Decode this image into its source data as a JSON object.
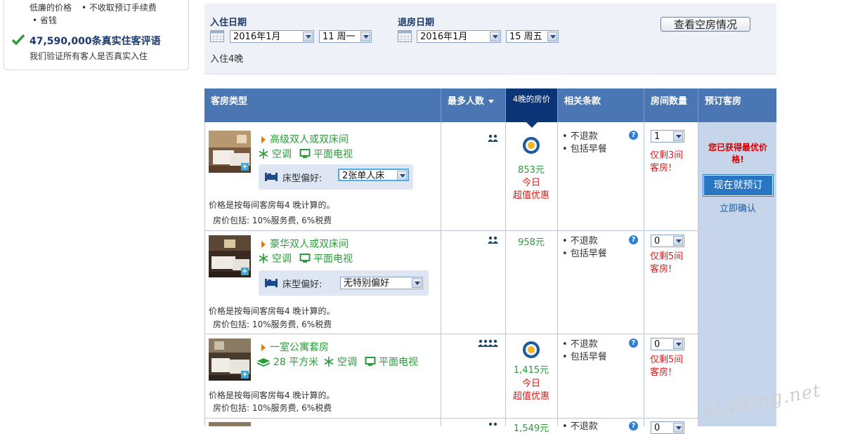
{
  "left_panel": {
    "line1_a": "低廉的价格",
    "line1_b": "• 不收取预订手续费",
    "line2": "• 省钱",
    "review_stat": "47,590,000条真实住客评语",
    "verify_note": "我们验证所有客人是否真实入住"
  },
  "search": {
    "checkin_label": "入住日期",
    "checkin_month": "2016年1月",
    "checkin_day": "11 周一",
    "checkout_label": "退房日期",
    "checkout_month": "2016年1月",
    "checkout_day": "15 周五",
    "nights": "入住4晚",
    "check_availability": "查看空房情况"
  },
  "table": {
    "headers": {
      "room_type": "客房类型",
      "max_people": "最多人数",
      "price": "4晚的房价",
      "conditions": "相关条款",
      "room_count": "房间数量",
      "book": "预订客房"
    },
    "rows": [
      {
        "name": "高级双人或双床间",
        "amenities": [
          "空调",
          "平面电视"
        ],
        "size": "",
        "bed_label": "床型偏好:",
        "bed_value": "2张单人床",
        "price": "853元",
        "deal": "今日",
        "deal2": "超值优惠",
        "cond1": "• 不退款",
        "cond2": "• 包括早餐",
        "qty": "1",
        "left": "仅剩3间",
        "left2": "客房!",
        "note1": "价格是按每间客房每4 晚计算的。",
        "note2": "房价包括: 10%服务费, 6%税费"
      },
      {
        "name": "豪华双人或双床间",
        "amenities": [
          "空调",
          "平面电视"
        ],
        "bed_label": "床型偏好:",
        "bed_value": "无特别偏好",
        "price": "958元",
        "cond1": "• 不退款",
        "cond2": "• 包括早餐",
        "qty": "0",
        "left": "仅剩5间",
        "left2": "客房!",
        "note1": "价格是按每间客房每4 晚计算的。",
        "note2": "房价包括: 10%服务费, 6%税费"
      },
      {
        "name": "一室公寓套房",
        "size": "28 平方米",
        "amenities": [
          "空调",
          "平面电视"
        ],
        "price": "1,415元",
        "deal": "今日",
        "deal2": "超值优惠",
        "cond1": "• 不退款",
        "cond2": "• 包括早餐",
        "qty": "0",
        "left": "仅剩5间",
        "left2": "客房!",
        "note1": "价格是按每间客房每4 晚计算的。",
        "note2": "房价包括: 10%服务费, 6%税费"
      }
    ],
    "partial_row": {
      "price": "1,549元",
      "cond1": "• 不退款",
      "qty": "0"
    }
  },
  "book": {
    "best_price": "您已获得最优价格!",
    "book_now": "现在就预订",
    "instant_confirm": "立即确认"
  },
  "watermark": "eLvXing.net",
  "colors": {
    "header_bg": "#4a77b4",
    "header_active": "#0b3576",
    "green": "#2a9c3a",
    "red": "#d42020",
    "book_button": "#2876c4"
  }
}
